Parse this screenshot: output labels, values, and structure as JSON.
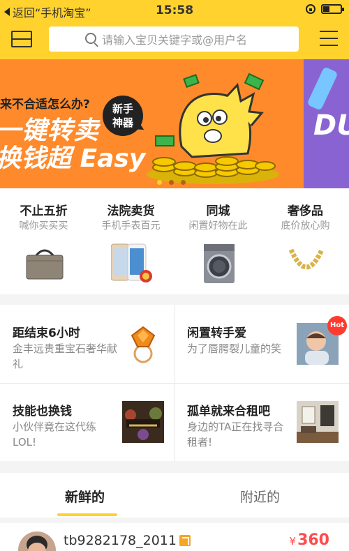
{
  "status_bar": {
    "back_label": "返回“手机淘宝”",
    "time": "15:58"
  },
  "search": {
    "placeholder": "请输入宝贝关键字或@用户名"
  },
  "banner": {
    "line1": "来不合适怎么办?",
    "line2": "一键转卖",
    "line3": "换钱超 Easy",
    "bubble_line1": "新手",
    "bubble_line2": "神器",
    "right_text": "DU"
  },
  "categories": [
    {
      "title": "不止五折",
      "subtitle": "喊你买买买",
      "icon": "handbag-icon"
    },
    {
      "title": "法院卖货",
      "subtitle": "手机手表百元",
      "icon": "phone-icon"
    },
    {
      "title": "同城",
      "subtitle": "闲置好物在此",
      "icon": "washing-machine-icon"
    },
    {
      "title": "奢侈品",
      "subtitle": "底价放心购",
      "icon": "necklace-icon"
    }
  ],
  "promos": [
    {
      "title": "距结束6小时",
      "desc": "金丰远贵重宝石奢华献礼",
      "icon": "gem-ring-icon"
    },
    {
      "title": "闲置转手爱",
      "desc": "为了唇腭裂儿童的笑",
      "icon": "child-photo-icon",
      "badge": "Hot"
    },
    {
      "title": "技能也换钱",
      "desc": "小伙伴竟在这代练LOL!",
      "icon": "game-poster-icon"
    },
    {
      "title": "孤单就来合租吧",
      "desc": "身边的TA正在找寻合租者!",
      "icon": "room-photo-icon"
    }
  ],
  "tabs": {
    "fresh": "新鲜的",
    "nearby": "附近的"
  },
  "feed": {
    "username": "tb9282178_2011",
    "currency": "¥",
    "price": "360"
  },
  "colors": {
    "brand_yellow": "#ffd22e",
    "banner_orange": "#ff8a2b",
    "price_red": "#ff4c4c"
  }
}
